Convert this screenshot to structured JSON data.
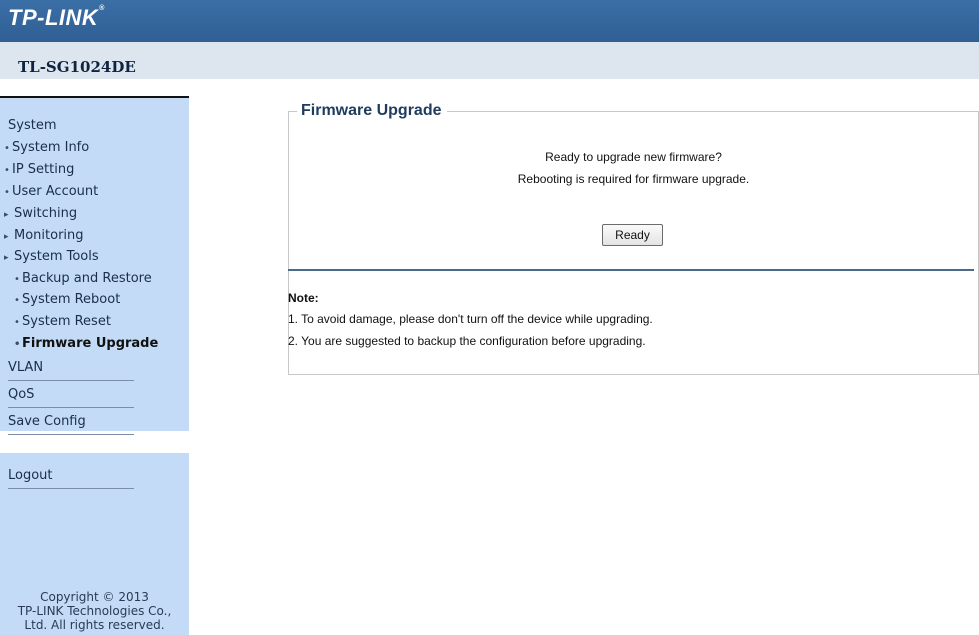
{
  "brand": {
    "logo_text": "TP-LINK",
    "logo_mark": "®",
    "model": "TL-SG1024DE"
  },
  "sidebar": {
    "items": [
      {
        "label": "System",
        "bullet": "",
        "level": 0
      },
      {
        "label": "System Info",
        "bullet": "•",
        "level": 1
      },
      {
        "label": "IP Setting",
        "bullet": "•",
        "level": 1
      },
      {
        "label": "User Account",
        "bullet": "•",
        "level": 1
      },
      {
        "label": "Switching",
        "bullet": "▸",
        "level": 1
      },
      {
        "label": "Monitoring",
        "bullet": "▸",
        "level": 1
      },
      {
        "label": "System Tools",
        "bullet": "▸",
        "level": 1
      },
      {
        "label": "Backup and Restore",
        "bullet": "•",
        "level": 2
      },
      {
        "label": "System Reboot",
        "bullet": "•",
        "level": 2
      },
      {
        "label": "System Reset",
        "bullet": "•",
        "level": 2
      },
      {
        "label": "Firmware Upgrade",
        "bullet": "•",
        "level": 2,
        "active": true
      },
      {
        "label": "VLAN",
        "bullet": "",
        "level": 0
      },
      {
        "label": "QoS",
        "bullet": "",
        "level": 0
      },
      {
        "label": "Save Config",
        "bullet": "",
        "level": 0
      },
      {
        "label": "Logout",
        "bullet": "",
        "level": 0
      }
    ],
    "copyright": [
      "Copyright © 2013",
      "TP-LINK Technologies Co.,",
      "Ltd. All rights reserved."
    ]
  },
  "main": {
    "section_title": "Firmware Upgrade",
    "prompt_line1": "Ready to upgrade new firmware?",
    "prompt_line2": "Rebooting is required for firmware upgrade.",
    "ready_button": "Ready",
    "note_title": "Note:",
    "notes": [
      "1. To avoid damage, please don't turn off the device while upgrading.",
      "2. You are suggested to backup the configuration before upgrading."
    ]
  },
  "colors": {
    "header": "#2f5f94",
    "sidebar": "#c3dbf6",
    "model_bar": "#dde5ee",
    "title": "#1f3b5e"
  }
}
